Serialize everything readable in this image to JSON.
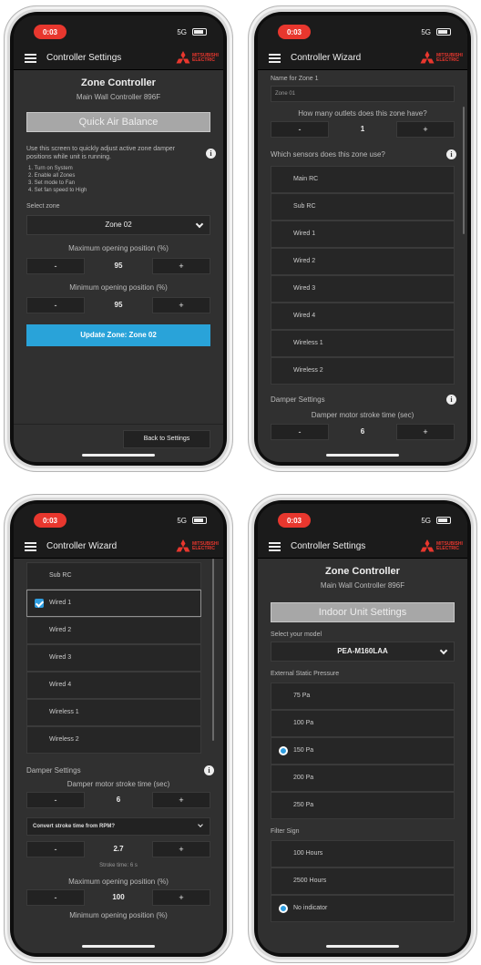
{
  "colors": {
    "accent": "#29a3d9",
    "status_pill": "#e8372e",
    "brand": "#e8372e",
    "bg": "#303030"
  },
  "phones": {
    "a": {
      "time": "0:03",
      "signal": "5G",
      "app_title": "Controller Settings",
      "logo": "MITSUBISHI ELECTRIC",
      "title": "Zone Controller",
      "subtitle": "Main Wall Controller 896F",
      "banner": "Quick Air Balance",
      "intro": "Use this screen to quickly adjust active zone damper positions while unit is running.",
      "steps": [
        "1. Turn on System",
        "2. Enable all Zones",
        "3. Set mode to Fan",
        "4. Set fan speed to High"
      ],
      "select_label": "Select zone",
      "select_value": "Zone 02",
      "max_label": "Maximum opening position (%)",
      "max_value": "95",
      "min_label": "Minimum opening position (%)",
      "min_value": "95",
      "minus": "-",
      "plus": "+",
      "update_btn": "Update Zone: Zone 02",
      "back_btn": "Back to Settings"
    },
    "b": {
      "time": "0:03",
      "signal": "5G",
      "app_title": "Controller Wizard",
      "logo": "MITSUBISHI ELECTRIC",
      "name_label": "Name for Zone 1",
      "name_value": "Zone 01",
      "outlets_label": "How many outlets does this zone have?",
      "outlets_value": "1",
      "sensors_label": "Which sensors does this zone use?",
      "sensors": [
        "Main RC",
        "Sub RC",
        "Wired 1",
        "Wired 2",
        "Wired 3",
        "Wired 4",
        "Wireless 1",
        "Wireless 2"
      ],
      "damper_label": "Damper Settings",
      "stroke_label": "Damper motor stroke time (sec)",
      "stroke_value": "6",
      "minus": "-",
      "plus": "+"
    },
    "c": {
      "time": "0:03",
      "signal": "5G",
      "app_title": "Controller Wizard",
      "logo": "MITSUBISHI ELECTRIC",
      "sensors": [
        "Sub RC",
        "Wired 1",
        "Wired 2",
        "Wired 3",
        "Wired 4",
        "Wireless 1",
        "Wireless 2"
      ],
      "checked": "Wired 1",
      "damper_label": "Damper Settings",
      "stroke_label": "Damper motor stroke time (sec)",
      "stroke_value": "6",
      "convert_label": "Convert stroke time from RPM?",
      "rpm_value": "2.7",
      "stroke_time": "Stroke time: 6 s",
      "max_label": "Maximum opening position (%)",
      "max_value": "100",
      "min_label": "Minimum opening position (%)",
      "minus": "-",
      "plus": "+"
    },
    "d": {
      "time": "0:03",
      "signal": "5G",
      "app_title": "Controller Settings",
      "logo": "MITSUBISHI ELECTRIC",
      "title": "Zone Controller",
      "subtitle": "Main Wall Controller 896F",
      "banner": "Indoor Unit Settings",
      "model_label": "Select your model",
      "model_value": "PEA-M160LAA",
      "esp_label": "External Static Pressure",
      "esp": [
        "75 Pa",
        "100 Pa",
        "150 Pa",
        "200 Pa",
        "250 Pa"
      ],
      "esp_selected": "150 Pa",
      "filter_label": "Filter Sign",
      "filter": [
        "100 Hours",
        "2500 Hours",
        "No indicator"
      ],
      "filter_selected": "No indicator"
    }
  }
}
